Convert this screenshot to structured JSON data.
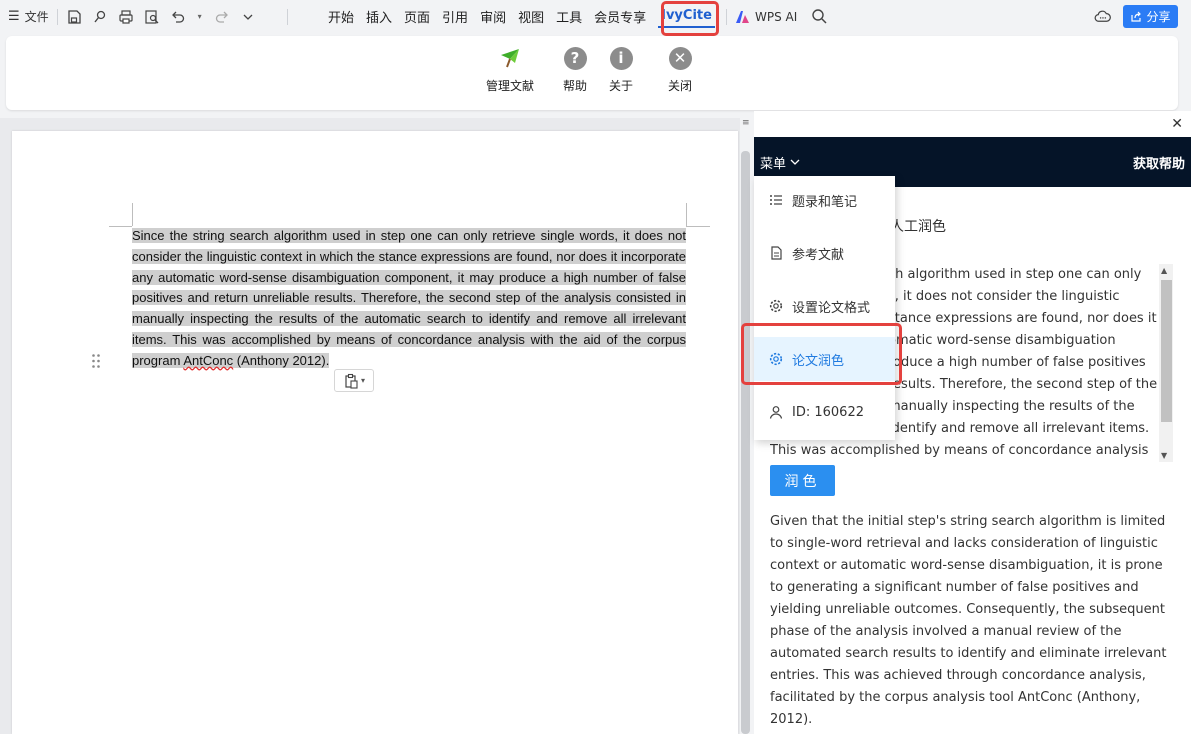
{
  "topbar": {
    "file_label": "文件",
    "tabs": [
      "开始",
      "插入",
      "页面",
      "引用",
      "审阅",
      "视图",
      "工具",
      "会员专享",
      "IvyCite"
    ],
    "wps_ai_label": "WPS AI",
    "share_label": "分享"
  },
  "ribbon": {
    "manage_label": "管理文献",
    "help_label": "帮助",
    "about_label": "关于",
    "close_label": "关闭"
  },
  "document": {
    "paragraph": "Since the string search algorithm used in step one can only retrieve single words, it does not consider the linguistic context in which the stance expressions are found, nor does it incorporate any automatic word-sense disambiguation component, it may produce a high number of false positives and return unreliable results. Therefore, the second step of the analysis consisted in manually inspecting the results of the automatic search to identify and remove all irrelevant items. This was accomplished by means of concordance analysis with the aid of the corpus program ",
    "squiggle_word": "AntConc",
    "paragraph_end": " (Anthony 2012)."
  },
  "panel": {
    "menu_label": "菜单",
    "help_label": "获取帮助",
    "section_title_visible": "人工润色",
    "source_lines": [
      "ch algorithm used in step one can only",
      "s, it does not consider the linguistic",
      "stance expressions are found, nor does it",
      "omatic word-sense disambiguation",
      "roduce a high number of false positives",
      "results. Therefore, the second step of the",
      " manually inspecting the results of the",
      " identify and remove all irrelevant items.",
      "This was accomplished by means of concordance analysis with"
    ],
    "polish_button": "润色",
    "result_text": "Given that the initial step's string search algorithm is limited to single-word retrieval and lacks consideration of linguistic context or automatic word-sense disambiguation, it is prone to generating a significant number of false positives and yielding unreliable outcomes. Consequently, the subsequent phase of the analysis involved a manual review of the automated search results to identify and eliminate irrelevant entries. This was achieved through concordance analysis, facilitated by the corpus analysis tool AntConc (Anthony, 2012)."
  },
  "dropdown": {
    "items": [
      "题录和笔记",
      "参考文献",
      "设置论文格式",
      "论文润色",
      "ID: 160622"
    ],
    "active_index": 3
  },
  "colors": {
    "accent": "#2b7cf5",
    "highlight_red": "#e4413e",
    "panel_header": "#051428"
  }
}
